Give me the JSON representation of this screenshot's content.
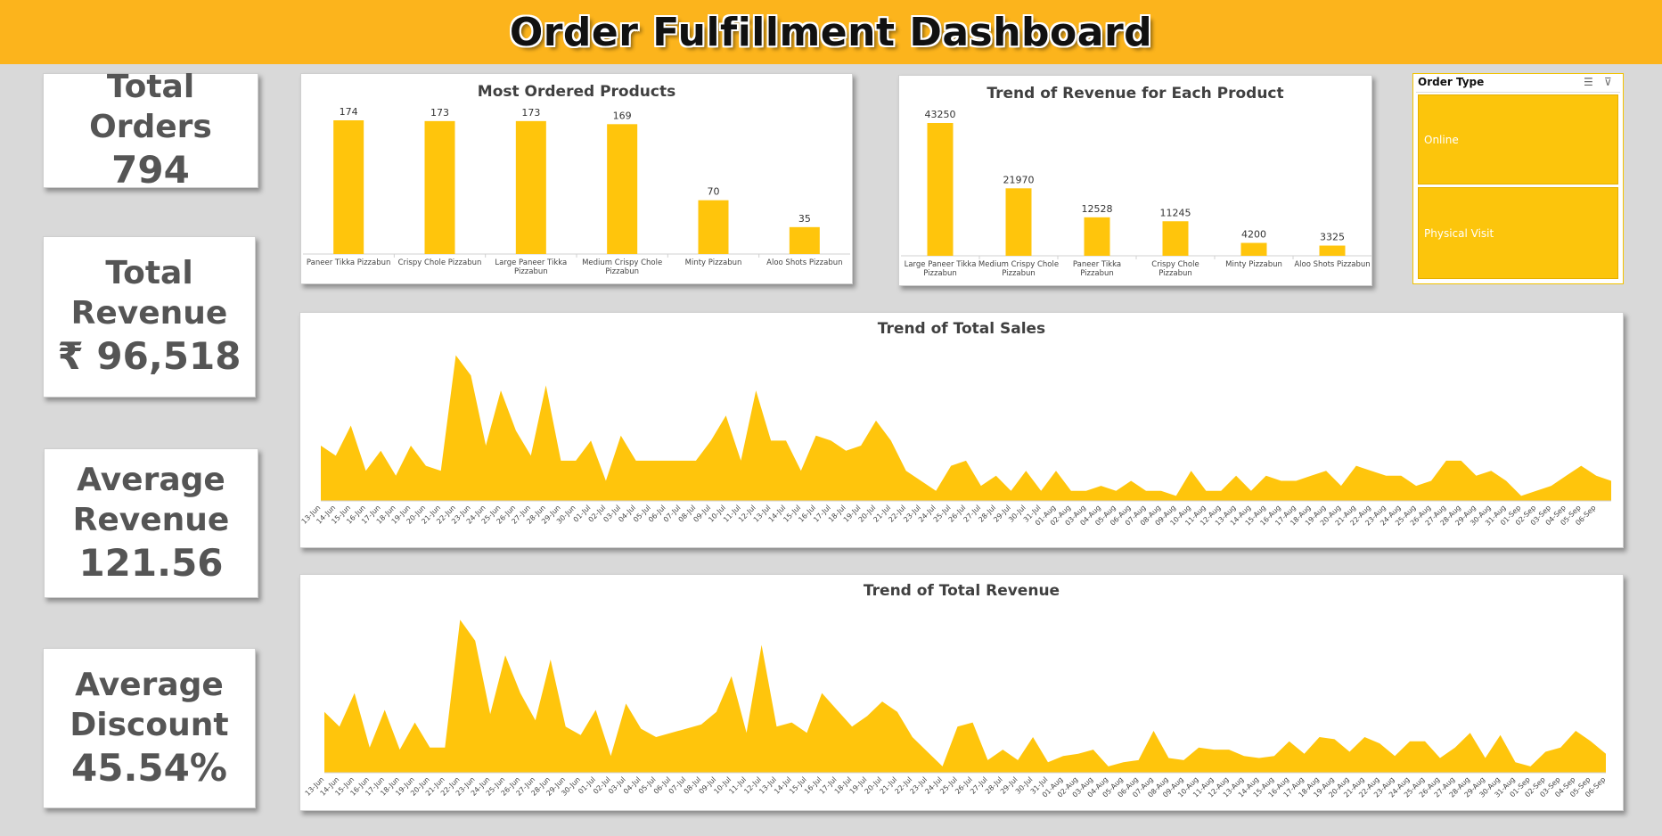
{
  "title": "Order Fulfillment Dashboard",
  "colors": {
    "banner": "#fcb41c",
    "bar": "#ffc50c",
    "area": "#ffc50c"
  },
  "kpis": {
    "total_orders": {
      "lines": [
        "Total Orders"
      ],
      "value": "794"
    },
    "total_revenue": {
      "lines": [
        "Total",
        "Revenue"
      ],
      "value": "₹ 96,518"
    },
    "avg_revenue": {
      "lines": [
        "Average",
        "Revenue"
      ],
      "value": "121.56"
    },
    "avg_discount": {
      "lines": [
        "Average",
        "Discount"
      ],
      "value": "45.54%"
    }
  },
  "slicer": {
    "title": "Order Type",
    "icons": [
      "multi-select-icon",
      "clear-filter-icon"
    ],
    "items": [
      "Online",
      "Physical Visit"
    ]
  },
  "chart_data": [
    {
      "id": "most_ordered",
      "type": "bar",
      "title": "Most Ordered Products",
      "categories": [
        "Paneer Tikka Pizzabun",
        "Crispy Chole Pizzabun",
        "Large Paneer Tikka Pizzabun",
        "Medium Crispy Chole Pizzabun",
        "Minty Pizzabun",
        "Aloo Shots Pizzabun"
      ],
      "values": [
        174,
        173,
        173,
        169,
        70,
        35
      ],
      "ylim": [
        0,
        174
      ],
      "data_labels": true
    },
    {
      "id": "revenue_by_product",
      "type": "bar",
      "title": "Trend of Revenue for Each Product",
      "categories": [
        "Large Paneer Tikka Pizzabun",
        "Medium Crispy Chole Pizzabun",
        "Paneer Tikka Pizzabun",
        "Crispy Chole Pizzabun",
        "Minty Pizzabun",
        "Aloo Shots Pizzabun"
      ],
      "values": [
        43250,
        21970,
        12528,
        11245,
        4200,
        3325
      ],
      "ylim": [
        0,
        43250
      ],
      "data_labels": true
    },
    {
      "id": "total_sales",
      "type": "area",
      "title": "Trend of Total Sales",
      "x": [
        "13-Jun",
        "14-Jun",
        "15-Jun",
        "16-Jun",
        "17-Jun",
        "18-Jun",
        "19-Jun",
        "20-Jun",
        "21-Jun",
        "22-Jun",
        "23-Jun",
        "24-Jun",
        "25-Jun",
        "26-Jun",
        "27-Jun",
        "28-Jun",
        "29-Jun",
        "30-Jun",
        "01-Jul",
        "02-Jul",
        "03-Jul",
        "04-Jul",
        "05-Jul",
        "06-Jul",
        "07-Jul",
        "08-Jul",
        "09-Jul",
        "10-Jul",
        "11-Jul",
        "12-Jul",
        "13-Jul",
        "14-Jul",
        "15-Jul",
        "16-Jul",
        "17-Jul",
        "18-Jul",
        "19-Jul",
        "20-Jul",
        "21-Jul",
        "22-Jul",
        "23-Jul",
        "24-Jul",
        "25-Jul",
        "26-Jul",
        "27-Jul",
        "28-Jul",
        "29-Jul",
        "30-Jul",
        "31-Jul",
        "01-Aug",
        "02-Aug",
        "03-Aug",
        "04-Aug",
        "05-Aug",
        "06-Aug",
        "07-Aug",
        "08-Aug",
        "09-Aug",
        "10-Aug",
        "11-Aug",
        "12-Aug",
        "13-Aug",
        "14-Aug",
        "15-Aug",
        "16-Aug",
        "17-Aug",
        "18-Aug",
        "19-Aug",
        "20-Aug",
        "21-Aug",
        "22-Aug",
        "23-Aug",
        "24-Aug",
        "25-Aug",
        "26-Aug",
        "27-Aug",
        "28-Aug",
        "29-Aug",
        "30-Aug",
        "31-Aug",
        "01-Sep",
        "02-Sep",
        "03-Sep",
        "04-Sep",
        "05-Sep",
        "06-Sep"
      ],
      "values": [
        11,
        9,
        15,
        6,
        10,
        5,
        11,
        7,
        6,
        29,
        25,
        11,
        22,
        14,
        9,
        23,
        8,
        8,
        12,
        4,
        13,
        8,
        8,
        8,
        8,
        8,
        12,
        17,
        8,
        22,
        12,
        12,
        6,
        13,
        12,
        10,
        11,
        16,
        12,
        6,
        4,
        2,
        7,
        8,
        3,
        5,
        2,
        6,
        2,
        6,
        2,
        2,
        3,
        2,
        4,
        2,
        2,
        1,
        6,
        2,
        2,
        5,
        2,
        5,
        4,
        4,
        5,
        6,
        3,
        7,
        6,
        5,
        5,
        3,
        4,
        8,
        8,
        5,
        6,
        4,
        1,
        2,
        3,
        5,
        7,
        5,
        4
      ],
      "ylim": [
        0,
        30
      ]
    },
    {
      "id": "total_revenue",
      "type": "area",
      "title": "Trend of Total Revenue",
      "x": [
        "13-Jun",
        "14-Jun",
        "15-Jun",
        "16-Jun",
        "17-Jun",
        "18-Jun",
        "19-Jun",
        "20-Jun",
        "21-Jun",
        "22-Jun",
        "23-Jun",
        "24-Jun",
        "25-Jun",
        "26-Jun",
        "27-Jun",
        "28-Jun",
        "29-Jun",
        "30-Jun",
        "01-Jul",
        "02-Jul",
        "03-Jul",
        "04-Jul",
        "05-Jul",
        "06-Jul",
        "07-Jul",
        "08-Jul",
        "09-Jul",
        "10-Jul",
        "11-Jul",
        "12-Jul",
        "13-Jul",
        "14-Jul",
        "15-Jul",
        "16-Jul",
        "17-Jul",
        "18-Jul",
        "19-Jul",
        "20-Jul",
        "21-Jul",
        "22-Jul",
        "23-Jul",
        "24-Jul",
        "25-Jul",
        "26-Jul",
        "27-Jul",
        "28-Jul",
        "29-Jul",
        "30-Jul",
        "31-Jul",
        "01-Aug",
        "02-Aug",
        "03-Aug",
        "04-Aug",
        "05-Aug",
        "06-Aug",
        "07-Aug",
        "08-Aug",
        "09-Aug",
        "10-Aug",
        "11-Aug",
        "12-Aug",
        "13-Aug",
        "14-Aug",
        "15-Aug",
        "16-Aug",
        "17-Aug",
        "18-Aug",
        "19-Aug",
        "20-Aug",
        "21-Aug",
        "22-Aug",
        "23-Aug",
        "24-Aug",
        "25-Aug",
        "26-Aug",
        "27-Aug",
        "28-Aug",
        "29-Aug",
        "30-Aug",
        "31-Aug",
        "01-Sep",
        "02-Sep",
        "03-Sep",
        "04-Sep",
        "05-Sep",
        "06-Sep"
      ],
      "values": [
        1450,
        1100,
        1900,
        600,
        1500,
        550,
        1200,
        600,
        600,
        3650,
        3150,
        1400,
        2800,
        1900,
        1250,
        2700,
        1100,
        900,
        1500,
        400,
        1650,
        1050,
        850,
        950,
        1050,
        1150,
        1450,
        2300,
        950,
        3050,
        1100,
        1200,
        950,
        1900,
        1500,
        1100,
        1350,
        1700,
        1450,
        850,
        500,
        150,
        1100,
        1200,
        300,
        550,
        300,
        850,
        250,
        400,
        450,
        550,
        150,
        250,
        300,
        1000,
        350,
        300,
        600,
        550,
        550,
        400,
        350,
        400,
        750,
        450,
        850,
        800,
        500,
        850,
        700,
        400,
        750,
        750,
        350,
        600,
        950,
        350,
        900,
        250,
        150,
        500,
        600,
        1000,
        750,
        450
      ],
      "ylim": [
        0,
        3700
      ]
    }
  ]
}
